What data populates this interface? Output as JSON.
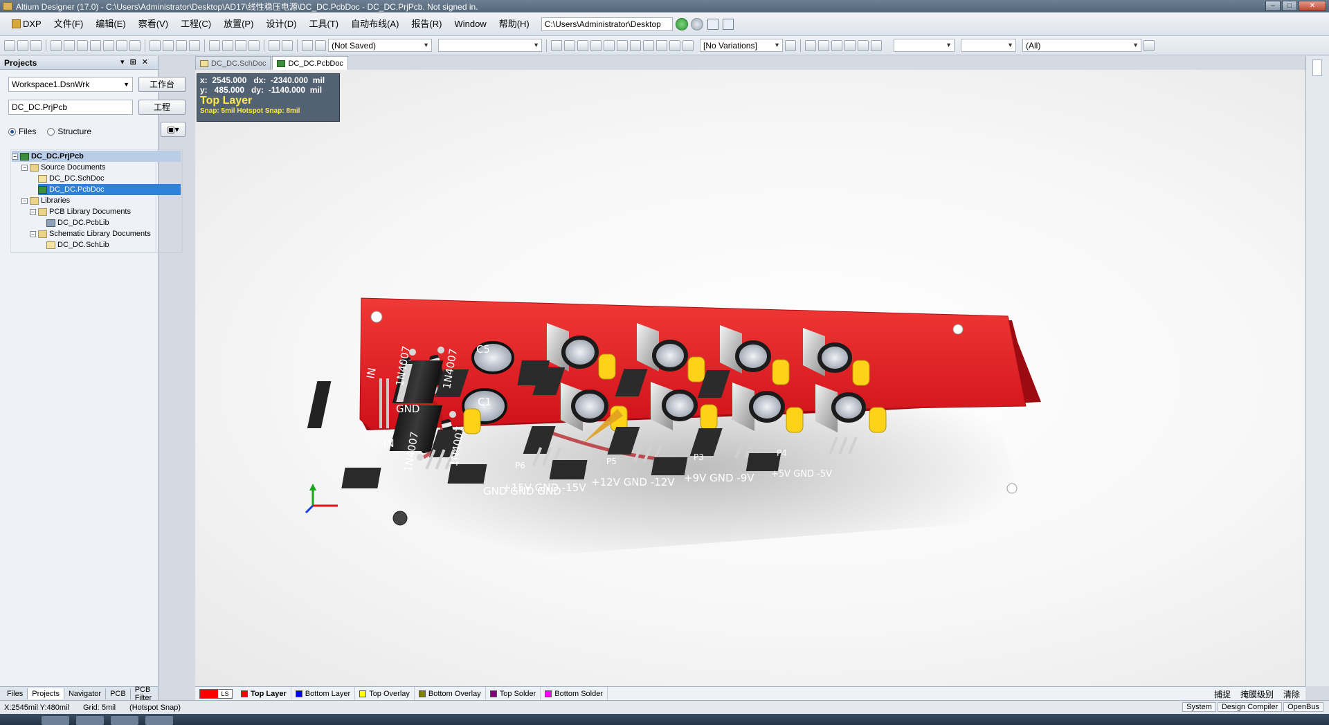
{
  "window": {
    "title": "Altium Designer (17.0) - C:\\Users\\Administrator\\Desktop\\AD17\\线性稳压电源\\DC_DC.PcbDoc - DC_DC.PrjPcb. Not signed in."
  },
  "menubar": {
    "items": [
      "DXP",
      "文件(F)",
      "编辑(E)",
      "察看(V)",
      "工程(C)",
      "放置(P)",
      "设计(D)",
      "工具(T)",
      "自动布线(A)",
      "报告(R)",
      "Window",
      "帮助(H)"
    ],
    "path": "C:\\Users\\Administrator\\Desktop"
  },
  "toolbar": {
    "saved_state": "(Not Saved)",
    "variations": "[No Variations]",
    "filter_all": "(All)"
  },
  "projects_panel": {
    "title": "Projects",
    "workspace": "Workspace1.DsnWrk",
    "workspace_button": "工作台",
    "project": "DC_DC.PrjPcb",
    "project_button": "工程",
    "view_files": "Files",
    "view_structure": "Structure",
    "tree": {
      "project": "DC_DC.PrjPcb",
      "source_documents": "Source Documents",
      "schdoc": "DC_DC.SchDoc",
      "pcbdoc": "DC_DC.PcbDoc",
      "libraries": "Libraries",
      "pcb_lib_docs": "PCB Library Documents",
      "pcblib": "DC_DC.PcbLib",
      "sch_lib_docs": "Schematic Library Documents",
      "schlib": "DC_DC.SchLib"
    }
  },
  "bottom_panel_tabs": [
    "Files",
    "Projects",
    "Navigator",
    "PCB",
    "PCB Filter"
  ],
  "document_tabs": [
    "DC_DC.SchDoc",
    "DC_DC.PcbDoc"
  ],
  "headsup": {
    "line1": "x:  2545.000   dx:  -2340.000  mil",
    "line2": "y:   485.000   dy:  -1140.000  mil",
    "layer": "Top Layer",
    "snap": "Snap: 5mil Hotspot Snap: 8mil"
  },
  "board": {
    "silkscreen": {
      "in_top": "IN",
      "gnd": "GND",
      "in_bottom": "IN",
      "d1": "1N4007",
      "d2": "1N4007",
      "d3": "1N4007",
      "d4": "1N4007",
      "c5": "C5",
      "c1": "C1",
      "gnd_header": "GND  GND  GND",
      "p6_label": "P6",
      "p6": "+15V  GND  -15V",
      "p5_label": "P5",
      "p5": "+12V  GND  -12V",
      "p3_label": "P3",
      "p3": "+9V  GND  -9V",
      "p4_label": "P4",
      "p4": "+5V  GND  -5V"
    }
  },
  "layer_tabs": {
    "current": "LS",
    "items": [
      {
        "label": "Top Layer",
        "color": "#ff0000"
      },
      {
        "label": "Bottom Layer",
        "color": "#0000ff"
      },
      {
        "label": "Top Overlay",
        "color": "#ffff00"
      },
      {
        "label": "Bottom Overlay",
        "color": "#808000"
      },
      {
        "label": "Top Solder",
        "color": "#800080"
      },
      {
        "label": "Bottom Solder",
        "color": "#ff00ff"
      }
    ],
    "right": [
      "捕捉",
      "掩膜级别",
      "清除"
    ]
  },
  "statusbar": {
    "coords": "X:2545mil Y:480mil",
    "grid": "Grid: 5mil",
    "snap": "(Hotspot Snap)",
    "right_buttons": [
      "System",
      "Design Compiler",
      "OpenBus"
    ]
  },
  "colors": {
    "board_red": "#e0121a",
    "accent_selection": "#2f80d8"
  }
}
